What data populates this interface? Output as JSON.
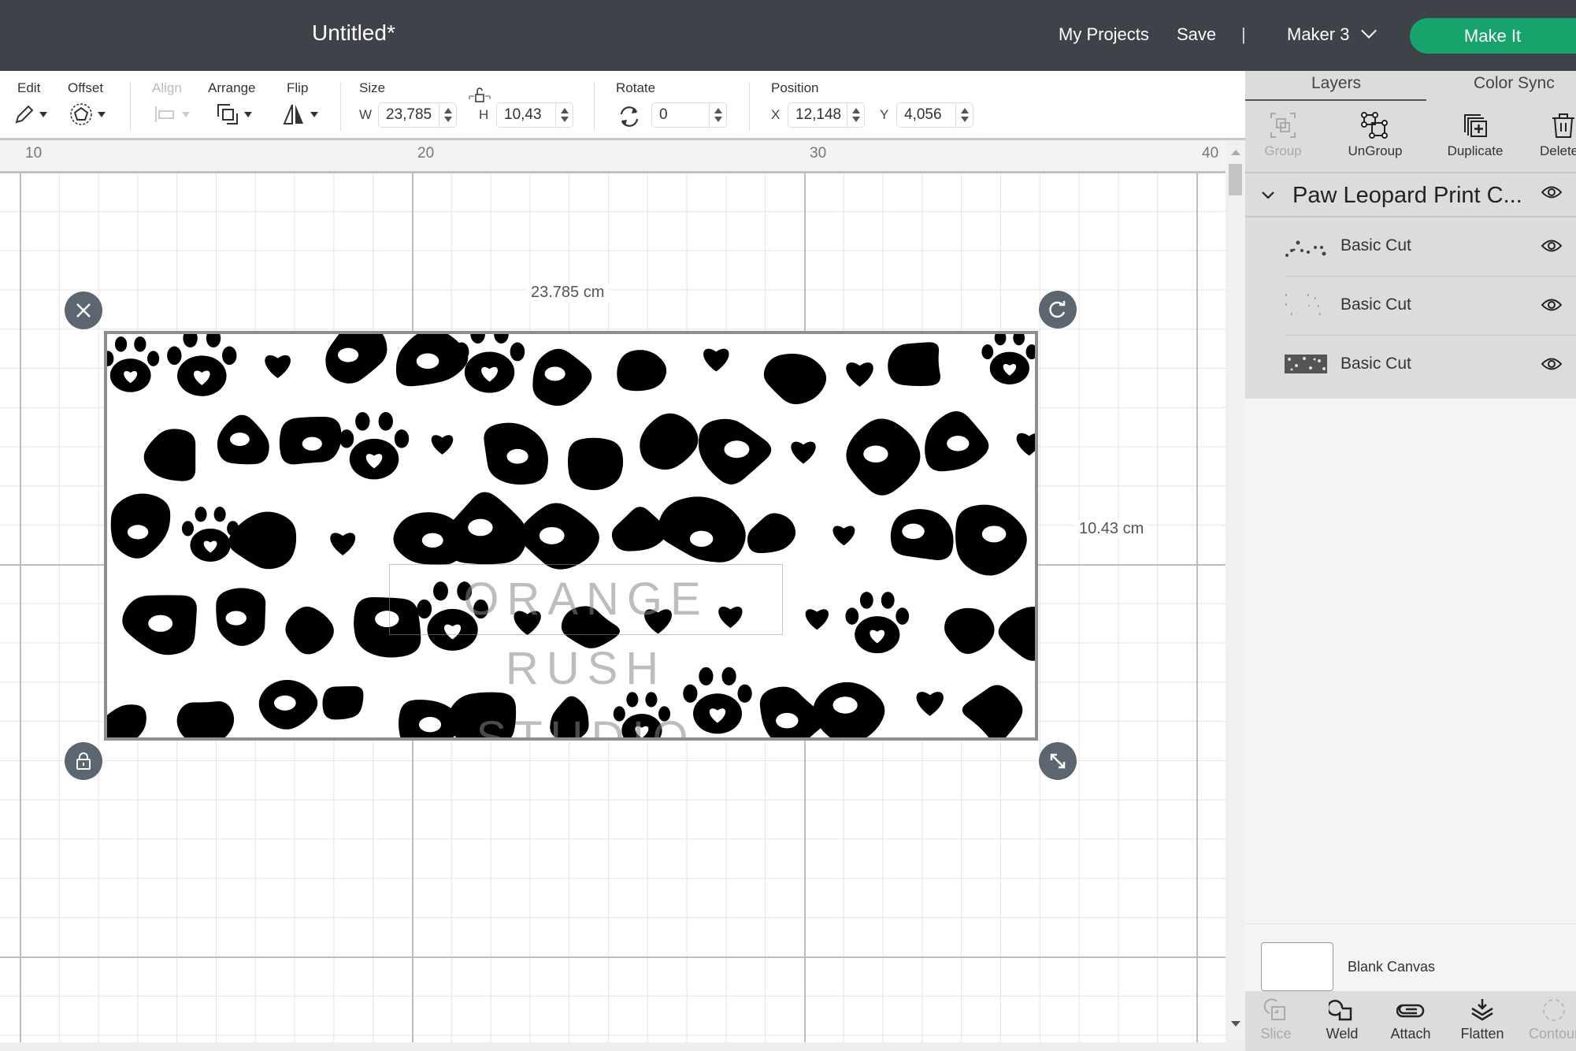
{
  "header": {
    "title": "Untitled*",
    "my_projects": "My Projects",
    "save": "Save",
    "separator": "|",
    "machine": "Maker 3",
    "make_it": "Make It",
    "make_it_color": "#17a36c"
  },
  "toolbar": {
    "edit": "Edit",
    "offset": "Offset",
    "align": "Align",
    "arrange": "Arrange",
    "flip": "Flip",
    "size": "Size",
    "w_label": "W",
    "w_value": "23,785",
    "h_label": "H",
    "h_value": "10,43",
    "rotate": "Rotate",
    "rotate_value": "0",
    "position": "Position",
    "x_label": "X",
    "x_value": "12,148",
    "y_label": "Y",
    "y_value": "4,056"
  },
  "ruler": {
    "ticks": [
      "10",
      "20",
      "30",
      "40"
    ]
  },
  "canvas": {
    "width_label": "23.785 cm",
    "height_label": "10.43 cm",
    "watermark": "ORANGE RUSH STUDIO"
  },
  "panel": {
    "tabs": [
      "Layers",
      "Color Sync"
    ],
    "actions": [
      "Group",
      "UnGroup",
      "Duplicate",
      "Delete"
    ],
    "group_name": "Paw Leopard Print C...",
    "layers": [
      {
        "name": "Basic Cut"
      },
      {
        "name": "Basic Cut"
      },
      {
        "name": "Basic Cut"
      }
    ],
    "blank_canvas": "Blank Canvas",
    "bottom_actions": [
      "Slice",
      "Weld",
      "Attach",
      "Flatten",
      "Contour"
    ]
  }
}
